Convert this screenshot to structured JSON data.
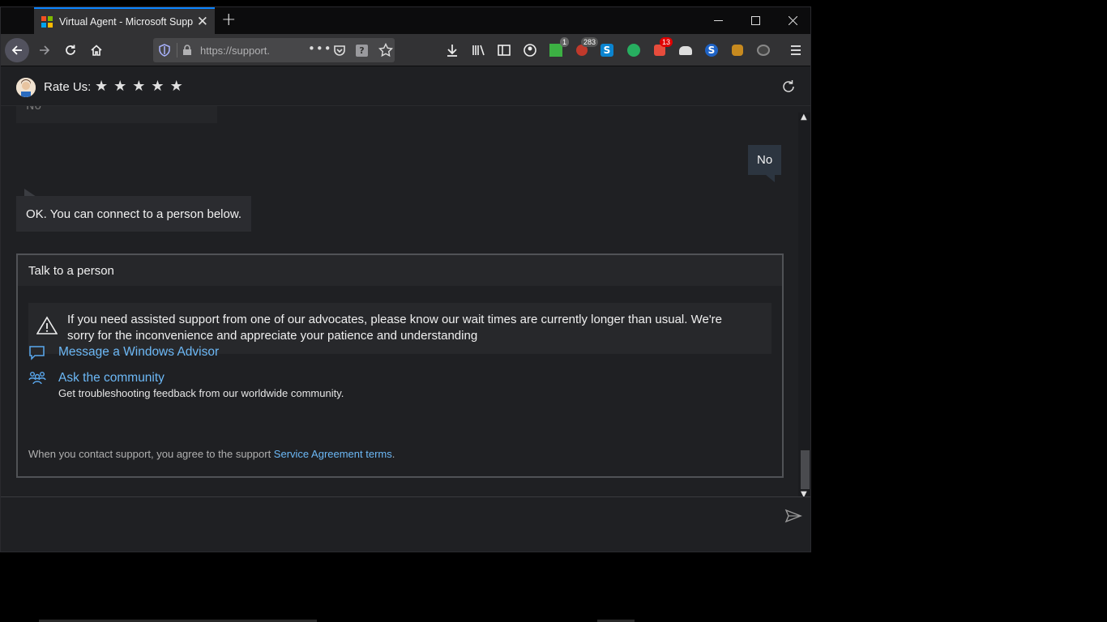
{
  "browser": {
    "tab_title": "Virtual Agent - Microsoft Support",
    "url": "https://support.",
    "badges": {
      "ext_green": "1",
      "ext_red_ghost": "283",
      "ext_red_13": "13"
    }
  },
  "chat": {
    "rate_label": "Rate Us:",
    "stars": [
      "★",
      "★",
      "★",
      "★",
      "★"
    ],
    "previous_reply": "No",
    "user_message": "No",
    "bot_message": "OK. You can connect to a person below."
  },
  "card": {
    "title": "Talk to a person",
    "warning": "If you need assisted support from one of our advocates, please know our wait times are currently longer than usual. We're sorry for the inconvenience and appreciate your patience and understanding",
    "options": [
      {
        "label": "Message a Windows Advisor",
        "description": ""
      },
      {
        "label": "Ask the community",
        "description": "Get troubleshooting feedback from our worldwide community."
      }
    ],
    "footnote_prefix": "When you contact support, you agree to the support ",
    "footnote_link": "Service Agreement terms",
    "footnote_suffix": "."
  },
  "input": {
    "placeholder": ""
  },
  "colors": {
    "accent_link": "#6cb8f6",
    "tab_accent": "#0a84ff",
    "background": "#1f2023"
  }
}
